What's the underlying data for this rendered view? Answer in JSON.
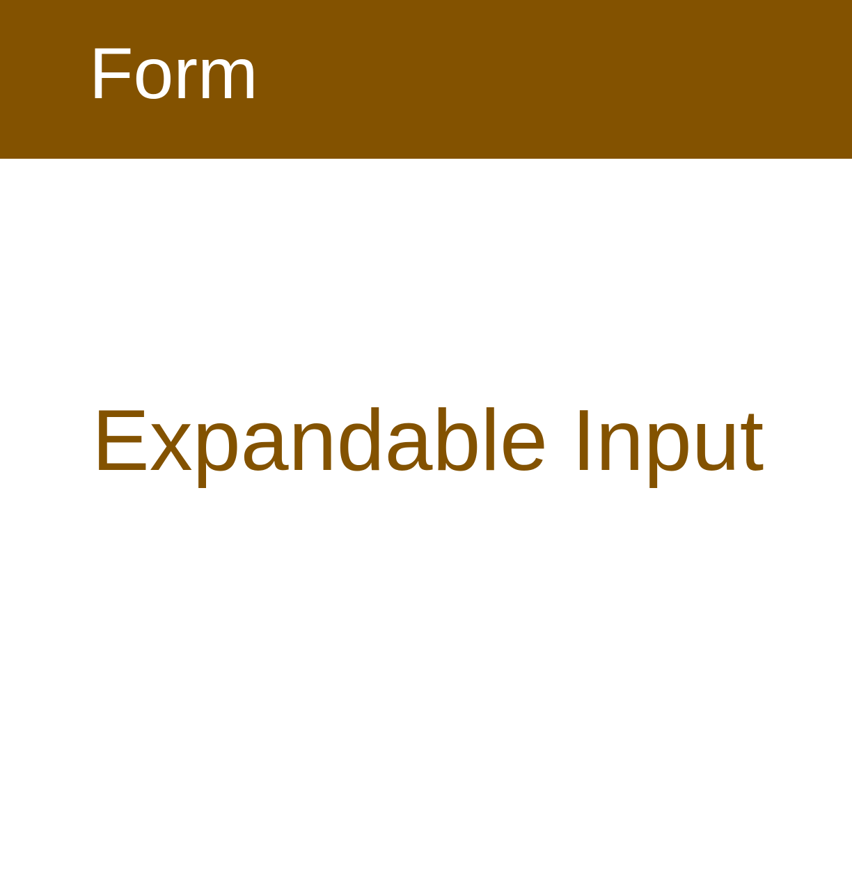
{
  "header": {
    "title": "Form"
  },
  "main": {
    "title": "Expandable Input"
  },
  "colors": {
    "brand": "#835200",
    "background": "#ffffff",
    "header_text": "#ffffff"
  }
}
